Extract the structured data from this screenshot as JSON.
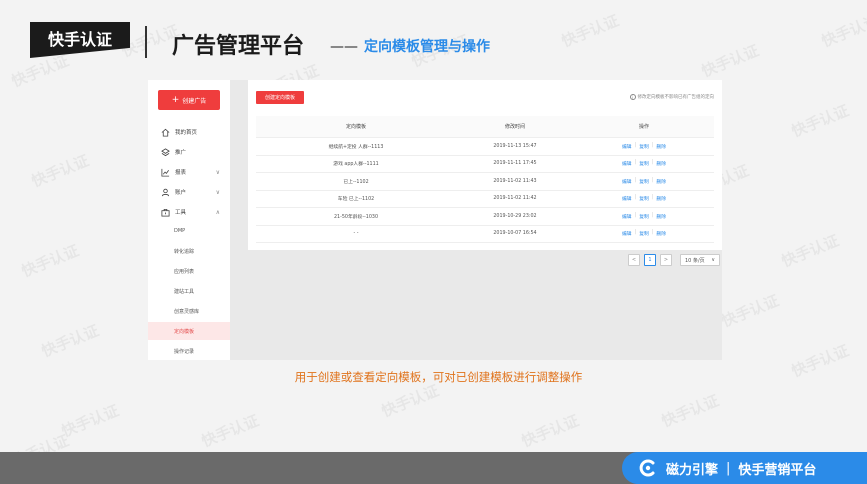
{
  "watermark": "快手认证",
  "header": {
    "logo_text": "快手认证",
    "title": "广告管理平台",
    "subtitle_dash": "——",
    "subtitle": "定向模板管理与操作"
  },
  "sidebar": {
    "create_button": "创建广告",
    "items": [
      {
        "label": "我的首页",
        "icon": "home-icon"
      },
      {
        "label": "推广",
        "icon": "layers-icon"
      },
      {
        "label": "报表",
        "icon": "chart-icon",
        "chevron": "∨"
      },
      {
        "label": "账户",
        "icon": "user-icon",
        "chevron": "∨"
      },
      {
        "label": "工具",
        "icon": "toolbox-icon",
        "chevron": "∧"
      }
    ],
    "sub_items": [
      {
        "label": "DMP"
      },
      {
        "label": "转化追踪"
      },
      {
        "label": "应用列表"
      },
      {
        "label": "建站工具"
      },
      {
        "label": "创意灵感库"
      },
      {
        "label": "定向模板",
        "active": true
      },
      {
        "label": "操作记录"
      }
    ]
  },
  "content": {
    "create_template_button": "创建定向模板",
    "hint": "修改定向模板不影响已有广告组的定向",
    "table": {
      "headers": [
        "定向模板",
        "修改时间",
        "操作"
      ],
      "rows": [
        {
          "name": "继续航+定投                人群--1113",
          "time": "2019-11-13 15:47"
        },
        {
          "name": "游戏              app人群--1111",
          "time": "2019-11-11 17:45"
        },
        {
          "name": "已上--1102",
          "time": "2019-11-02 11:43"
        },
        {
          "name": "车险    已上--1102",
          "time": "2019-11-02 11:42"
        },
        {
          "name": "21-50年龄段--1030",
          "time": "2019-10-29 23:02"
        },
        {
          "name": "-             -",
          "time": "2019-10-07 16:54"
        }
      ],
      "ops": {
        "edit": "编辑",
        "copy": "复制",
        "delete": "删除",
        "sep": "|"
      }
    },
    "pager": {
      "prev": "<",
      "current": "1",
      "next": ">",
      "page_size": "10 条/页",
      "page_size_arrow": "∨"
    }
  },
  "caption": "用于创建或查看定向模板，可对已创建模板进行调整操作",
  "footer": {
    "brand1": "磁力引擎",
    "sep": "|",
    "brand2": "快手营销平台"
  },
  "colors": {
    "accent_red": "#ef3d3d",
    "accent_blue": "#2b8be8",
    "caption_orange": "#e0731c"
  }
}
